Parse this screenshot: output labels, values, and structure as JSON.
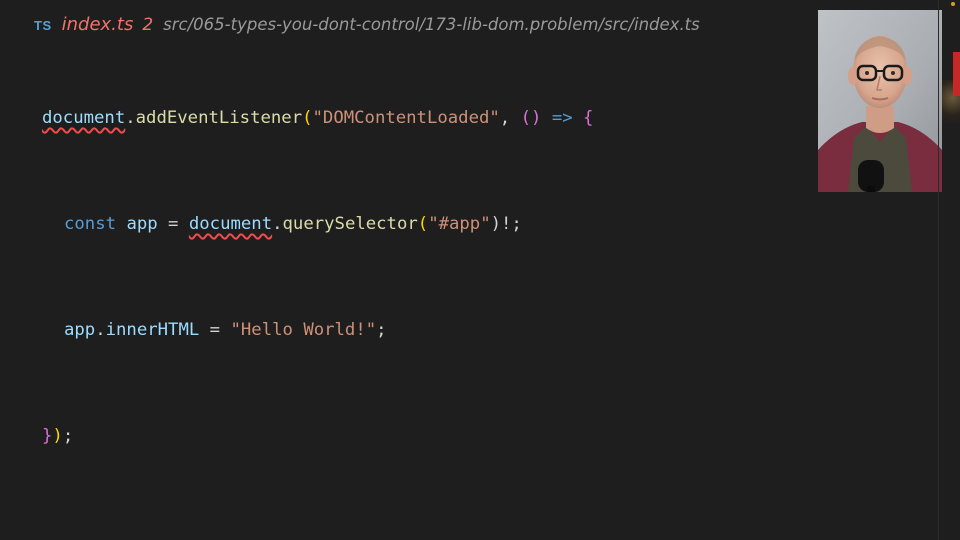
{
  "tab": {
    "language_badge": "TS",
    "file_name": "index.ts",
    "problem_count": "2",
    "path": "src/065-types-you-dont-control/173-lib-dom.problem/src/index.ts"
  },
  "code": {
    "line1": {
      "document": "document",
      "dot": ".",
      "method": "addEventListener",
      "open_paren": "(",
      "event_string": "\"DOMContentLoaded\"",
      "comma": ", ",
      "arrow_params": "()",
      "arrow": " => ",
      "open_brace": "{"
    },
    "line2": {
      "keyword": "const",
      "var_name": "app",
      "equals": " = ",
      "document": "document",
      "dot": ".",
      "method": "querySelector",
      "open_paren": "(",
      "selector_string": "\"#app\"",
      "close": ")!;"
    },
    "line3": {
      "object": "app",
      "dot": ".",
      "property": "innerHTML",
      "equals": " = ",
      "value_string": "\"Hello World!\"",
      "semicolon": ";"
    },
    "line4": {
      "close_brace": "}",
      "close_paren": ")",
      "semicolon": ";"
    }
  },
  "colors": {
    "background": "#1e1e1e",
    "error": "#f14c4c",
    "tab_filename": "#f2726c",
    "ts_badge": "#4fa2dc",
    "variable": "#9cdcfe",
    "function": "#dcdcaa",
    "string": "#ce9178",
    "keyword": "#569cd6"
  },
  "webcam": {
    "icon": "presenter-webcam"
  }
}
